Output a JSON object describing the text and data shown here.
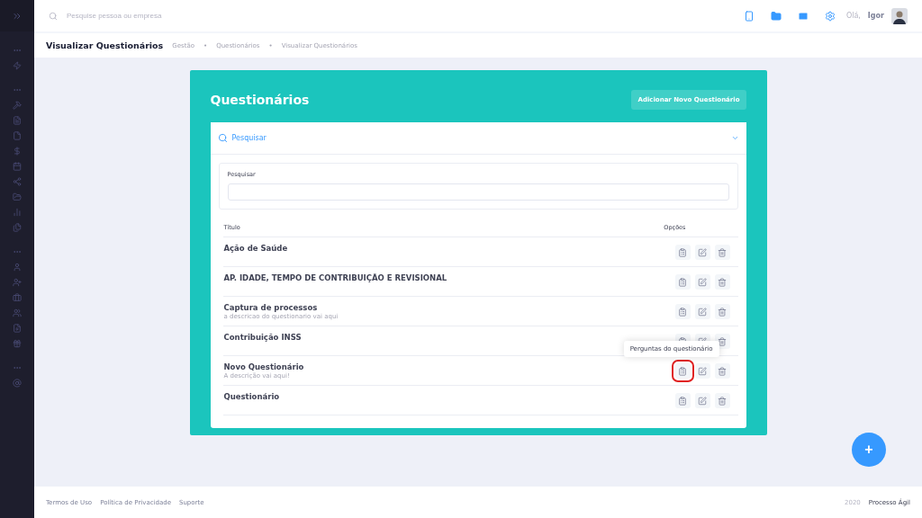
{
  "topbar": {
    "search_placeholder": "Pesquise pessoa ou empresa",
    "greeting": "Olá,",
    "user": "Igor"
  },
  "subheader": {
    "title": "Visualizar Questionários",
    "breadcrumbs": [
      "Gestão",
      "Questionários",
      "Visualizar Questionários"
    ],
    "separator": "•"
  },
  "panel": {
    "title": "Questionários",
    "add_button": "Adicionar Novo Questionário",
    "filter": {
      "title": "Pesquisar",
      "expanded": true,
      "field_label": "Pesquisar"
    },
    "columns": [
      "Título",
      "Opções"
    ],
    "rows": [
      {
        "title": "Ação de Saúde"
      },
      {
        "title": "AP. IDADE, TEMPO DE CONTRIBUIÇÃO E REVISIONAL"
      },
      {
        "title": "Captura de processos",
        "description": "a descricao do questionario vai aqui"
      },
      {
        "title": "Contribuição INSS"
      },
      {
        "title": "Novo Questionário",
        "description": "A descrição vai aqui!",
        "tooltip": "Perguntas do questionário"
      },
      {
        "title": "Questionário"
      }
    ]
  },
  "footer": {
    "links": [
      "Termos de Uso",
      "Política de Privacidade",
      "Suporte"
    ],
    "year": "2020",
    "brand": "Processo Ágil"
  },
  "fab": {
    "label": "+"
  }
}
